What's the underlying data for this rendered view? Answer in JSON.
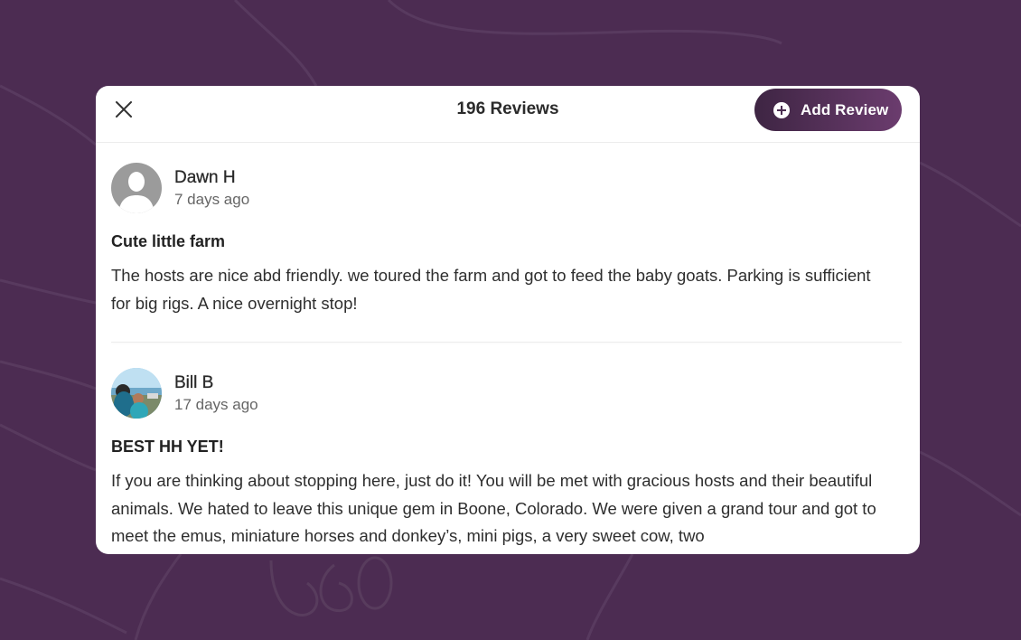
{
  "modal": {
    "title": "196 Reviews",
    "add_review_label": "Add Review"
  },
  "reviews": [
    {
      "name": "Dawn H",
      "date": "7 days ago",
      "title": "Cute little farm",
      "body": "The hosts are nice abd friendly. we toured the farm and got to feed the baby goats. Parking is sufficient for big rigs. A nice overnight stop!",
      "avatar": "default-user-avatar"
    },
    {
      "name": "Bill B",
      "date": "17 days ago",
      "title": "BEST HH YET!",
      "body": "If you are thinking about stopping here, just do it! You will be met with gracious hosts and their beautiful animals. We hated to leave this unique gem in Boone, Colorado. We were given a grand tour and  got to meet the emus, miniature horses and donkey’s, mini pigs, a very sweet cow, two",
      "avatar": "photo-avatar"
    }
  ],
  "colors": {
    "background": "#4c2c52",
    "button_gradient_start": "#3e2543",
    "button_gradient_end": "#6b3c6e"
  }
}
